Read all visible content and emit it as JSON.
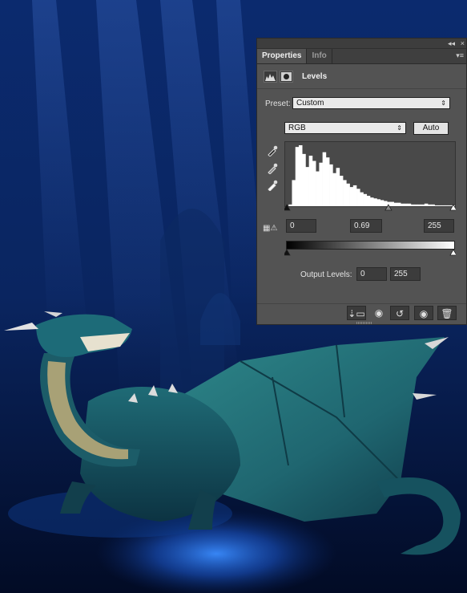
{
  "panel": {
    "tabs": [
      {
        "label": "Properties",
        "active": true
      },
      {
        "label": "Info",
        "active": false
      }
    ],
    "topbar_glyphs": {
      "collapse": "◂◂",
      "close": "×"
    },
    "tab_menu_glyph": "▾≡",
    "adjustment_title": "Levels",
    "preset": {
      "label": "Preset:",
      "value": "Custom"
    },
    "channel": {
      "value": "RGB"
    },
    "auto_button": "Auto",
    "input_levels": {
      "black": "0",
      "gamma": "0.69",
      "white": "255"
    },
    "output_levels": {
      "label": "Output Levels:",
      "black": "0",
      "white": "255"
    },
    "histogram": {
      "description_values": [
        0,
        2,
        30,
        68,
        70,
        60,
        45,
        58,
        52,
        40,
        50,
        62,
        56,
        48,
        38,
        44,
        35,
        30,
        26,
        22,
        24,
        20,
        16,
        14,
        12,
        10,
        9,
        8,
        7,
        6,
        5,
        5,
        4,
        4,
        3,
        3,
        3,
        2,
        2,
        2,
        2,
        3,
        2,
        2,
        1,
        1,
        1,
        1,
        1,
        1
      ]
    },
    "input_slider_positions": {
      "black": 0.0,
      "gamma": 0.61,
      "white": 1.0
    },
    "output_slider_positions": {
      "black": 0.0,
      "white": 1.0
    },
    "icons": {
      "eyedroppers": [
        "eyedropper-black-icon",
        "eyedropper-gray-icon",
        "eyedropper-white-icon"
      ],
      "bottom": [
        "clip-to-layer-icon",
        "view-previous-state-icon",
        "reset-icon",
        "visibility-icon",
        "delete-icon"
      ]
    }
  },
  "colors": {
    "panel_bg": "#535353",
    "background_top": "#0d2a66",
    "background_bottom": "#03102e"
  }
}
